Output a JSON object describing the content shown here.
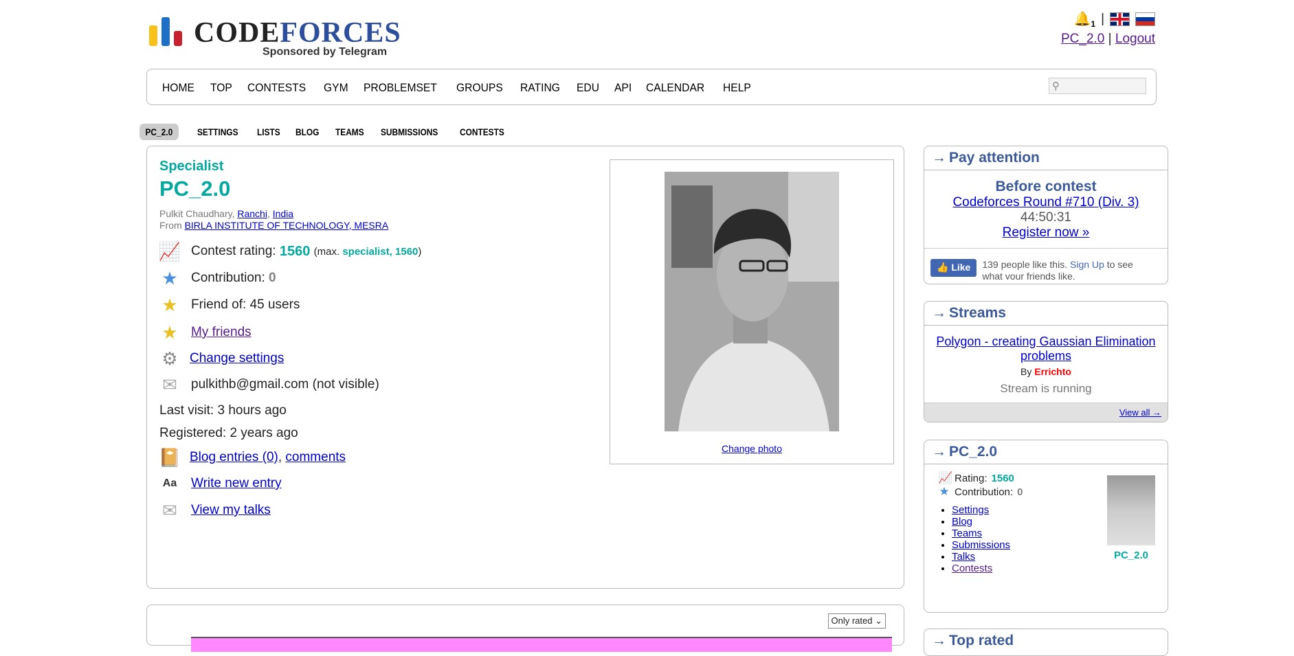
{
  "header": {
    "logo_code": "CODE",
    "logo_forces": "FORCES",
    "sponsor": "Sponsored by Telegram",
    "notifications_count": "1",
    "username": "PC_2.0",
    "logout": "Logout",
    "separator": "|"
  },
  "menu": {
    "items": [
      "HOME",
      "TOP",
      "CONTESTS",
      "GYM",
      "PROBLEMSET",
      "GROUPS",
      "RATING",
      "EDU",
      "API",
      "CALENDAR",
      "HELP"
    ],
    "search_placeholder": ""
  },
  "subtabs": [
    "PC_2.0",
    "SETTINGS",
    "LISTS",
    "BLOG",
    "TEAMS",
    "SUBMISSIONS",
    "CONTESTS"
  ],
  "profile": {
    "rank": "Specialist",
    "handle": "PC_2.0",
    "name": "Pulkit Chaudhary,",
    "city": "Ranchi",
    "comma": ",",
    "country": "India",
    "from_label": "From",
    "organization": "BIRLA INSTITUTE OF TECHNOLOGY, MESRA",
    "contest_rating_label": "Contest rating:",
    "contest_rating": "1560",
    "max_prefix": "(max.",
    "max_rank_rating": "specialist, 1560",
    "max_suffix": ")",
    "contribution_label": "Contribution:",
    "contribution": "0",
    "friend_of": "Friend of: 45 users",
    "my_friends": "My friends",
    "change_settings": "Change settings",
    "email": "pulkithb@gmail.com (not visible)",
    "last_visit": "Last visit: 3 hours ago",
    "registered": "Registered: 2 years ago",
    "blog_entries": "Blog entries (0)",
    "comments": "comments",
    "write_new_entry": "Write new entry",
    "view_talks": "View my talks",
    "change_photo": "Change photo",
    "rated_filter": "Only rated ⌄"
  },
  "sidebar": {
    "pay_attention": {
      "title": "Pay attention",
      "before_contest": "Before contest",
      "contest_name": "Codeforces Round #710 (Div. 3)",
      "timer": "44:50:31",
      "register": "Register now »",
      "fb_like": "Like",
      "fb_text_pre": "139 people like this.",
      "fb_signup": "Sign Up",
      "fb_text_post": "to see what your friends like."
    },
    "streams": {
      "title": "Streams",
      "stream_title": "Polygon - creating Gaussian Elimination problems",
      "by_label": "By",
      "author": "Errichto",
      "status": "Stream is running",
      "view_all": "View all →"
    },
    "user_box": {
      "title": "PC_2.0",
      "rating_label": "Rating:",
      "rating": "1560",
      "contribution_label": "Contribution:",
      "contribution": "0",
      "links": [
        "Settings",
        "Blog",
        "Teams",
        "Submissions",
        "Talks",
        "Contests"
      ],
      "avatar_name": "PC_2.0"
    },
    "top_rated": {
      "title": "Top rated"
    }
  },
  "colors": {
    "specialist": "#03a89e",
    "caption": "#3b5998",
    "link": "#0000cc",
    "visited": "#551a8b"
  }
}
